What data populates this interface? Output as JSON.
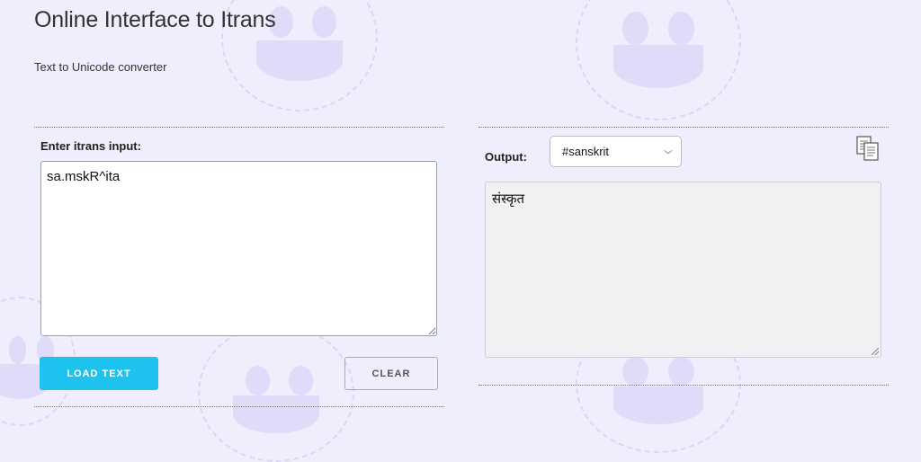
{
  "header": {
    "title": "Online Interface to Itrans",
    "subtitle": "Text to Unicode converter"
  },
  "input_panel": {
    "label": "Enter itrans input:",
    "value": "sa.mskR^ita",
    "load_button": "LOAD TEXT",
    "clear_button": "CLEAR"
  },
  "output_panel": {
    "label": "Output:",
    "selected_script": "#sanskrit",
    "output_text": "संस्कृत",
    "copy_icon": "copy-icon"
  },
  "colors": {
    "background": "#efeefc",
    "accent": "#1dc3ee",
    "input_border": "#3cc3e6",
    "output_background": "#f1f1f3"
  }
}
